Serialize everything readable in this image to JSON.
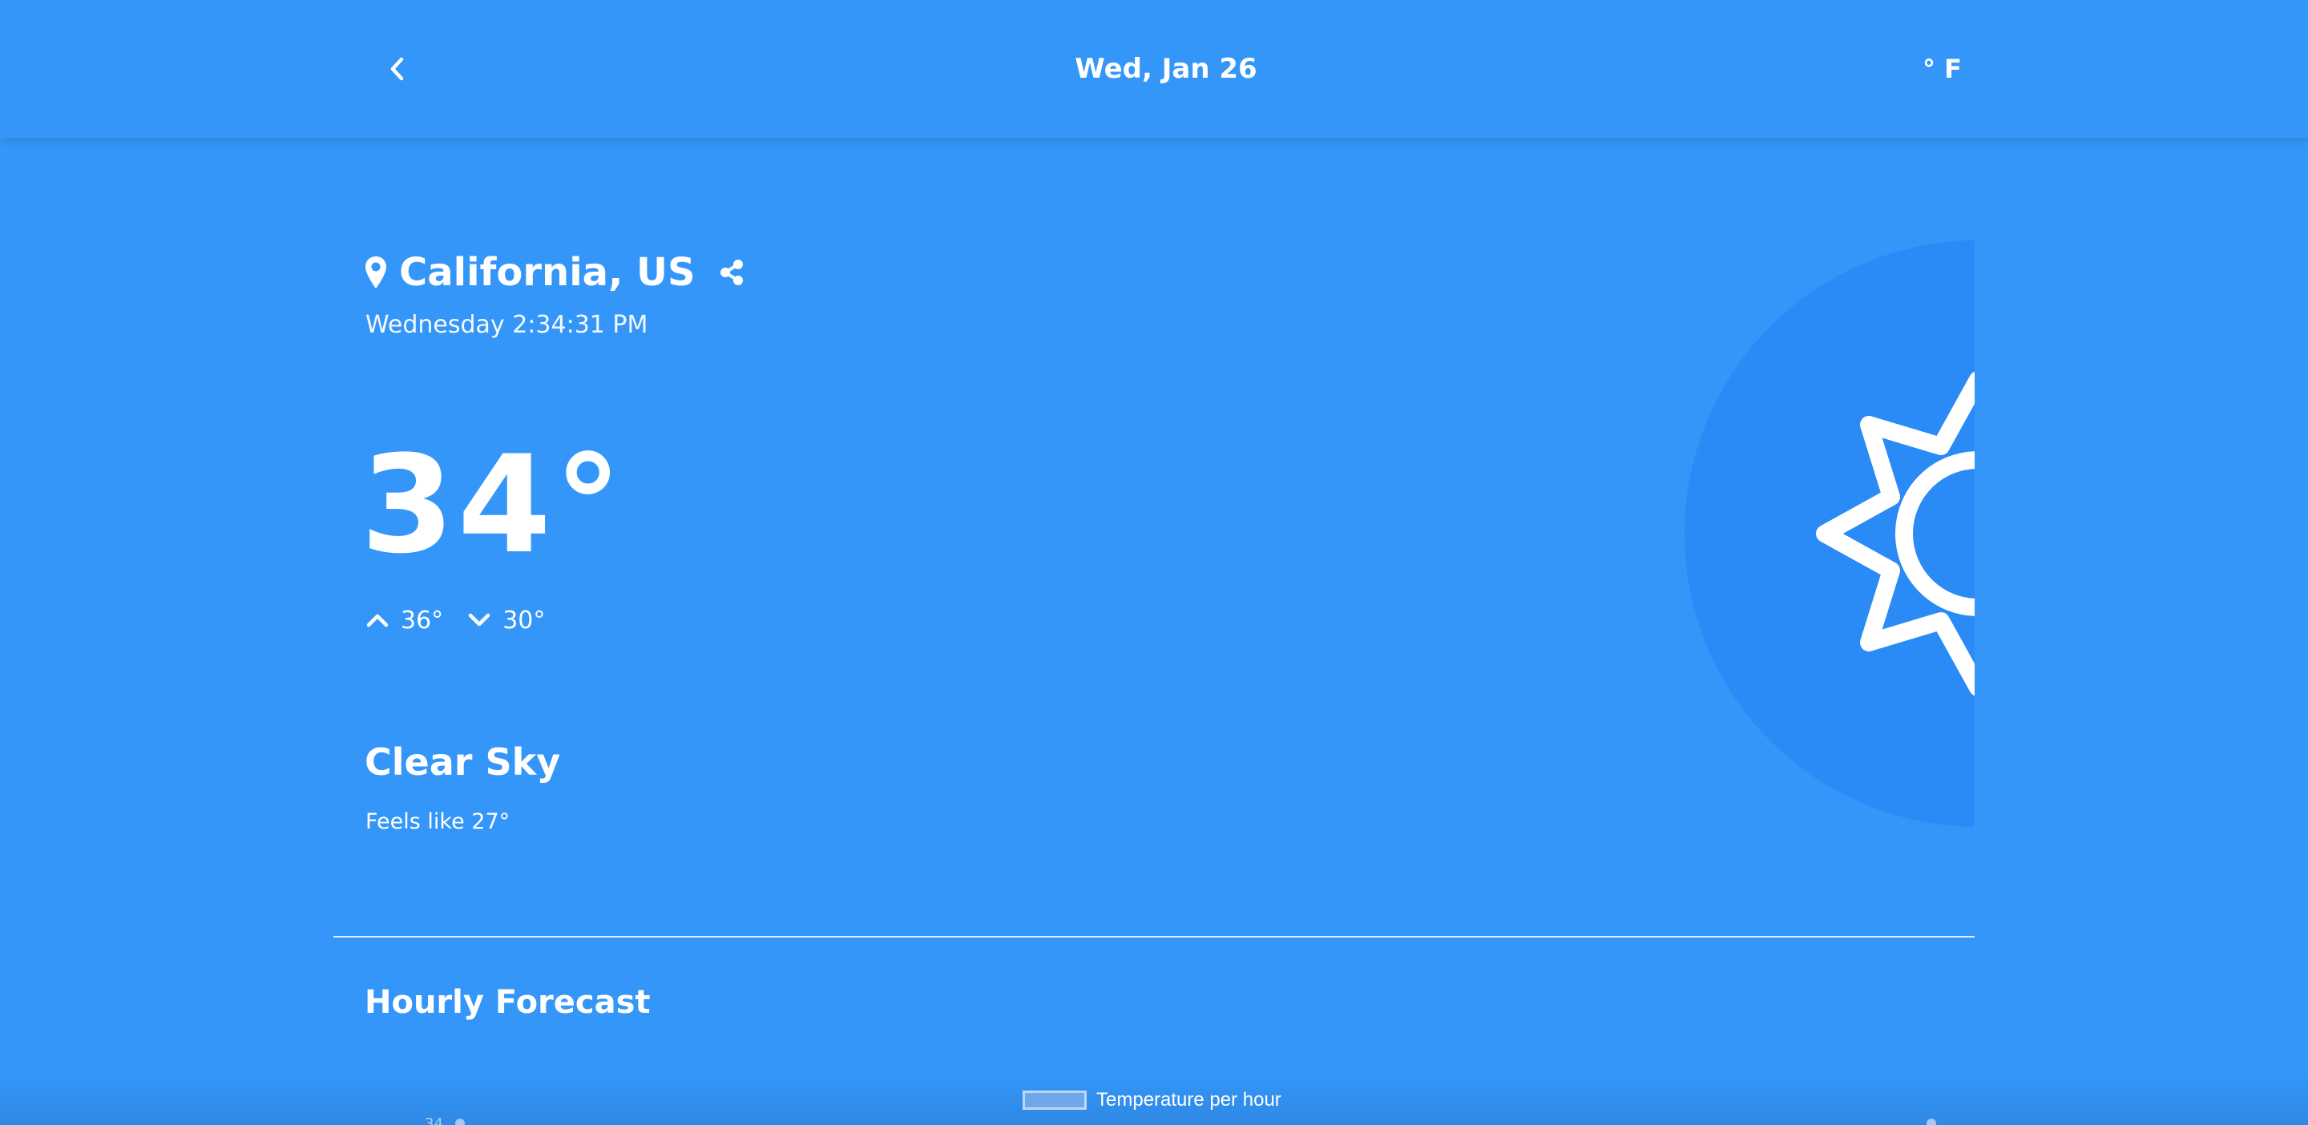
{
  "header": {
    "back_icon": "chevron-left-icon",
    "date": "Wed, Jan 26",
    "unit_toggle": "° F"
  },
  "location": {
    "pin_icon": "map-pin-icon",
    "name": "California, US",
    "share_icon": "share-icon",
    "datetime": "Wednesday 2:34:31 PM"
  },
  "current": {
    "temperature": "34°",
    "high": "36°",
    "low": "30°",
    "high_icon": "chevron-up-icon",
    "low_icon": "chevron-down-icon",
    "condition": "Clear Sky",
    "feels_like": "Feels like 27°",
    "weather_icon": "sun-icon"
  },
  "hourly": {
    "title": "Hourly Forecast",
    "legend_label": "Temperature per hour",
    "first_tick": "34"
  },
  "colors": {
    "background": "#3396f8",
    "icon_circle": "#2a8bf6",
    "text": "#ffffff"
  }
}
